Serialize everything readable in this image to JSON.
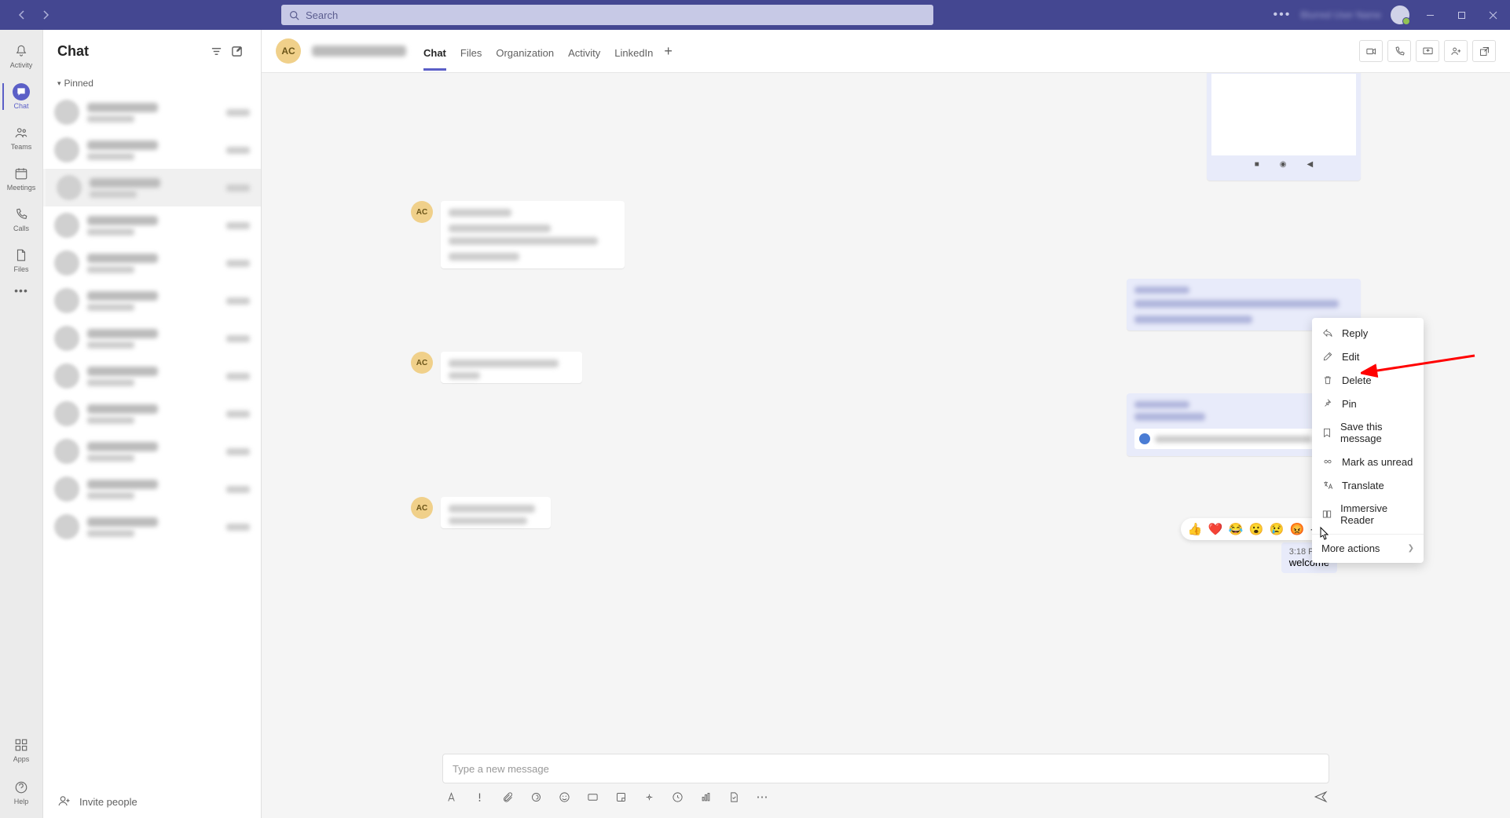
{
  "title_bar": {
    "search_placeholder": "Search",
    "user_name": "Blurred User Name"
  },
  "rail": {
    "items": [
      {
        "label": "Activity"
      },
      {
        "label": "Chat"
      },
      {
        "label": "Teams"
      },
      {
        "label": "Meetings"
      },
      {
        "label": "Calls"
      },
      {
        "label": "Files"
      }
    ],
    "bottom": [
      {
        "label": "Apps"
      },
      {
        "label": "Help"
      }
    ]
  },
  "chat_list": {
    "title": "Chat",
    "pinned_label": "Pinned",
    "invite_label": "Invite people"
  },
  "chat_header": {
    "avatar_initials": "AC",
    "tabs": [
      {
        "label": "Chat"
      },
      {
        "label": "Files"
      },
      {
        "label": "Organization"
      },
      {
        "label": "Activity"
      },
      {
        "label": "LinkedIn"
      }
    ]
  },
  "messages": {
    "avatar_initials": "AC",
    "welcome_time": "3:18 PM",
    "welcome_text": "welcome"
  },
  "compose": {
    "placeholder": "Type a new message"
  },
  "context_menu": {
    "items": [
      {
        "label": "Reply",
        "icon": "reply"
      },
      {
        "label": "Edit",
        "icon": "edit"
      },
      {
        "label": "Delete",
        "icon": "delete"
      },
      {
        "label": "Pin",
        "icon": "pin"
      },
      {
        "label": "Save this message",
        "icon": "save"
      },
      {
        "label": "Mark as unread",
        "icon": "unread"
      },
      {
        "label": "Translate",
        "icon": "translate"
      },
      {
        "label": "Immersive Reader",
        "icon": "reader"
      }
    ],
    "more_label": "More actions"
  },
  "reactions": [
    "👍",
    "❤️",
    "😂",
    "😮",
    "😢",
    "😡"
  ]
}
